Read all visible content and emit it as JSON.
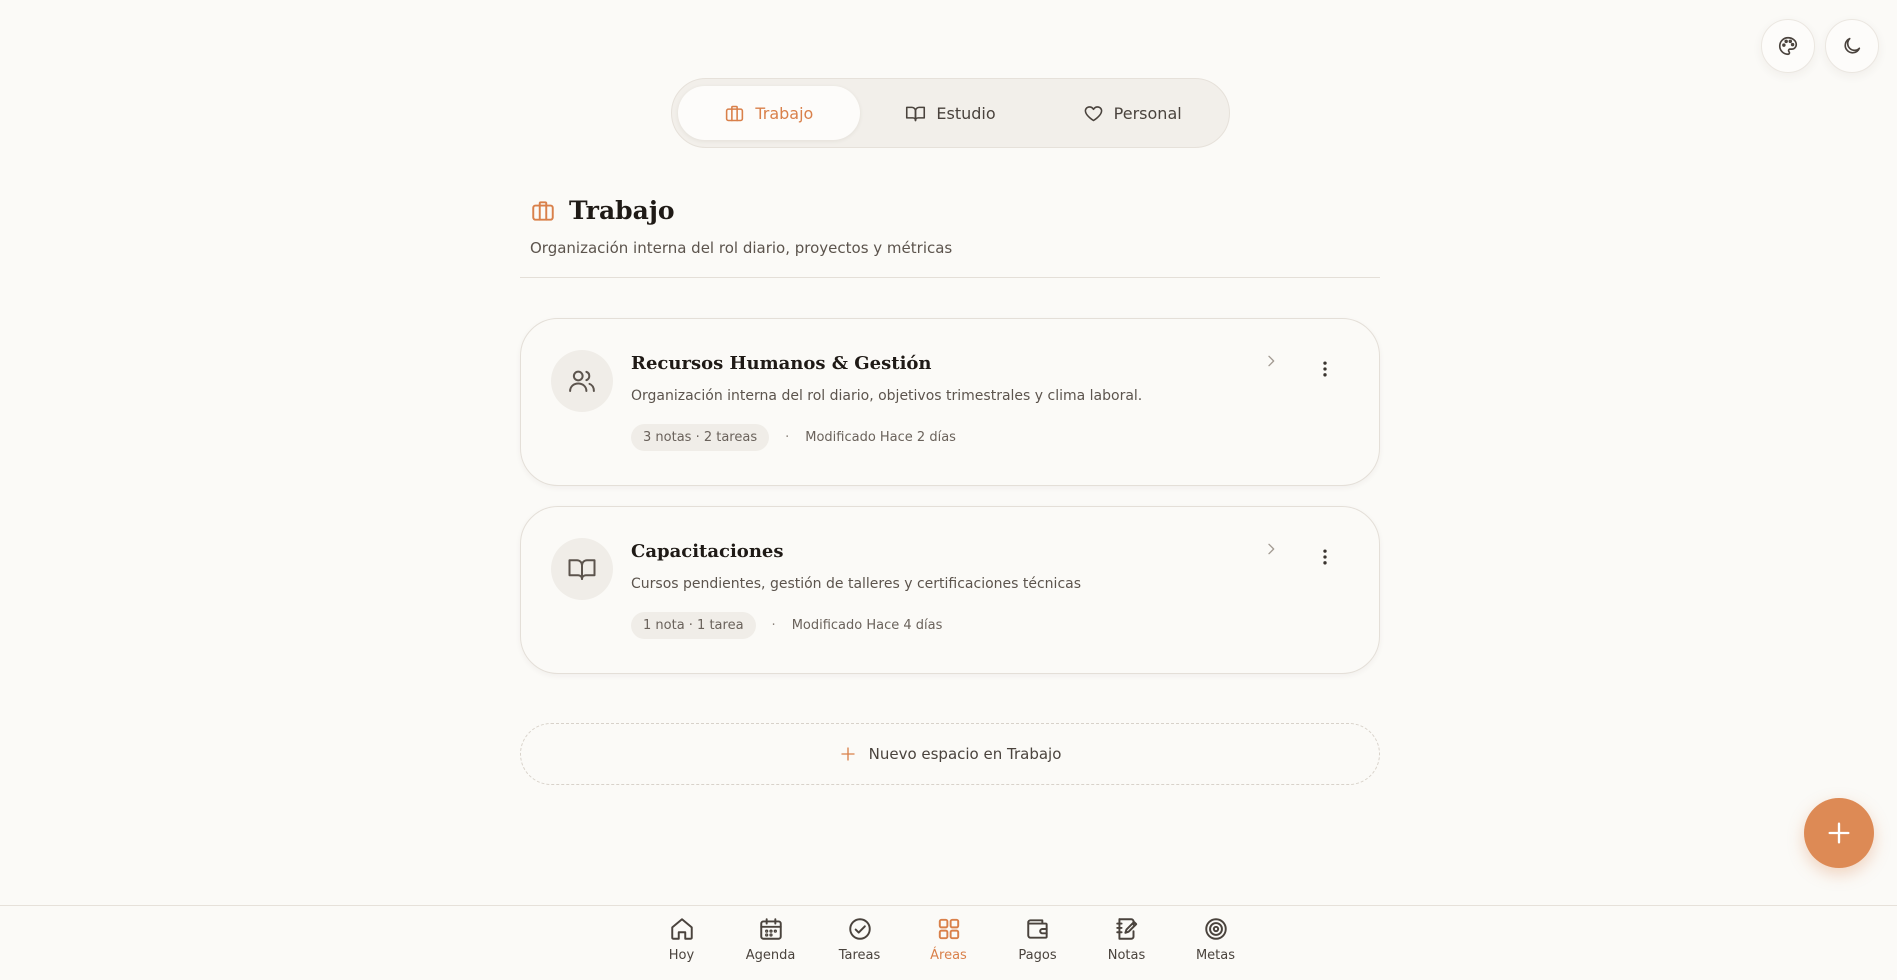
{
  "top_actions": {
    "palette_icon": "palette-icon",
    "moon_icon": "moon-icon"
  },
  "tabs": [
    {
      "label": "Trabajo",
      "icon": "briefcase-icon",
      "active": true
    },
    {
      "label": "Estudio",
      "icon": "book-open-icon",
      "active": false
    },
    {
      "label": "Personal",
      "icon": "heart-icon",
      "active": false
    }
  ],
  "section": {
    "title": "Trabajo",
    "subtitle": "Organización interna del rol diario, proyectos y métricas",
    "icon": "briefcase-icon"
  },
  "spaces": [
    {
      "title": "Recursos Humanos & Gestión",
      "description": "Organización interna del rol diario, objetivos trimestrales y clima laboral.",
      "counts": "3 notas · 2 tareas",
      "separator": "·",
      "modified": "Modificado Hace 2 días",
      "icon": "users-icon"
    },
    {
      "title": "Capacitaciones",
      "description": "Cursos pendientes, gestión de talleres y certificaciones técnicas",
      "counts": "1 nota · 1 tarea",
      "separator": "·",
      "modified": "Modificado Hace 4 días",
      "icon": "book-open-icon"
    }
  ],
  "new_space_label": "Nuevo espacio en Trabajo",
  "nav": [
    {
      "label": "Hoy",
      "icon": "home-icon",
      "active": false
    },
    {
      "label": "Agenda",
      "icon": "calendar-icon",
      "active": false
    },
    {
      "label": "Tareas",
      "icon": "check-circle-icon",
      "active": false
    },
    {
      "label": "Áreas",
      "icon": "grid-icon",
      "active": true
    },
    {
      "label": "Pagos",
      "icon": "wallet-icon",
      "active": false
    },
    {
      "label": "Notas",
      "icon": "notebook-icon",
      "active": false
    },
    {
      "label": "Metas",
      "icon": "target-icon",
      "active": false
    }
  ],
  "colors": {
    "accent": "#dd8a55",
    "background": "#fbfaf7",
    "text": "#2b2622"
  }
}
